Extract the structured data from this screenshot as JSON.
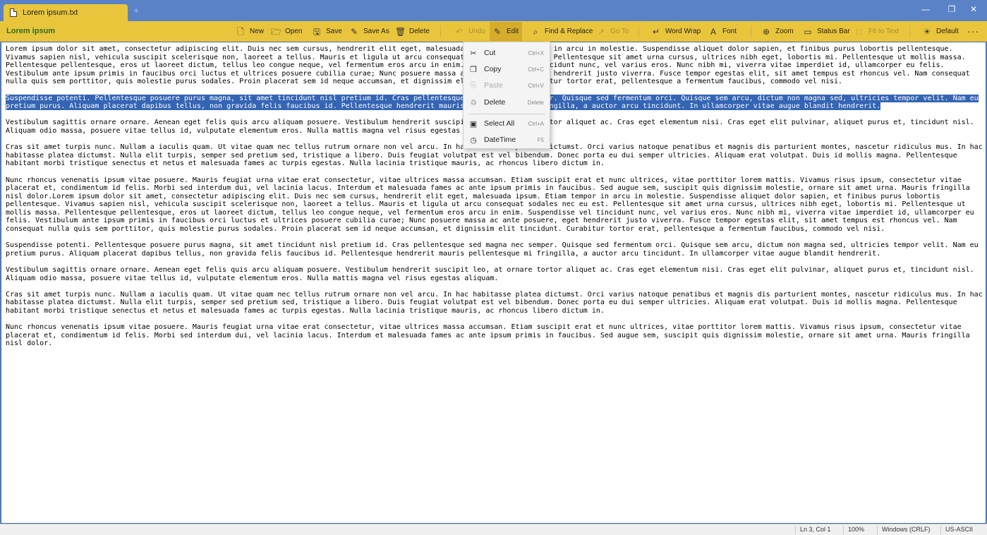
{
  "window": {
    "tab_label": "Lorem ipsum.txt",
    "new_tab_glyph": "+",
    "min_glyph": "—",
    "max_glyph": "❐",
    "close_glyph": "✕"
  },
  "toolbar": {
    "doc_title": "Lorem ipsum",
    "buttons": {
      "new": "New",
      "open": "Open",
      "save": "Save",
      "save_as": "Save As",
      "delete": "Delete",
      "undo": "Undo",
      "edit": "Edit",
      "find_replace": "Find & Replace",
      "go_to": "Go To",
      "word_wrap": "Word Wrap",
      "font": "Font",
      "zoom": "Zoom",
      "status_bar": "Status Bar",
      "fit_to_text": "Fit to Text",
      "default": "Default"
    },
    "more": "···"
  },
  "editor": {
    "paragraphs": [
      "Lorem ipsum dolor sit amet, consectetur adipiscing elit. Duis nec sem cursus, hendrerit elit eget, malesuada ipsum. Etiam tempor in arcu in molestie. Suspendisse aliquet dolor sapien, et finibus purus lobortis pellentesque. Vivamus sapien nisl, vehicula suscipit scelerisque non, laoreet a tellus. Mauris et ligula ut arcu consequat sodales nec eu est. Pellentesque sit amet urna cursus, ultrices nibh eget, lobortis mi. Pellentesque ut mollis massa. Pellentesque pellentesque, eros ut laoreet dictum, tellus leo congue neque, vel fermentum eros arcu in enim. Suspendisse vel tincidunt nunc, vel varius eros. Nunc nibh mi, viverra vitae imperdiet id, ullamcorper eu felis. Vestibulum ante ipsum primis in faucibus orci luctus et ultrices posuere cubilia curae; Nunc posuere massa ac ante posuere, eget hendrerit justo viverra. Fusce tempor egestas elit, sit amet tempus est rhoncus vel. Nam consequat nulla quis sem porttitor, quis molestie purus sodales. Proin placerat sem id neque accumsan, et dignissim elit tincidunt. Curabitur tortor erat, pellentesque a fermentum faucibus, commodo vel nisi.",
      "Suspendisse potenti. Pellentesque posuere purus magna, sit amet tincidunt nisl pretium id. Cras pellentesque sed magna nec semper. Quisque sed fermentum orci. Quisque sem arcu, dictum non magna sed, ultricies tempor velit. Nam eu pretium purus. Aliquam placerat dapibus tellus, non gravida felis faucibus id. Pellentesque hendrerit mauris pellentesque mi fringilla, a auctor arcu tincidunt. In ullamcorper vitae augue blandit hendrerit.",
      "Vestibulum sagittis ornare ornare. Aenean eget felis quis arcu aliquam posuere. Vestibulum hendrerit suscipit leo, at ornare tortor aliquet ac. Cras eget elementum nisi. Cras eget elit pulvinar, aliquet purus et, tincidunt nisl. Aliquam odio massa, posuere vitae tellus id, vulputate elementum eros. Nulla mattis magna vel risus egestas aliquam.",
      "Cras sit amet turpis nunc. Nullam a iaculis quam. Ut vitae quam nec tellus rutrum ornare non vel arcu. In hac habitasse platea dictumst. Orci varius natoque penatibus et magnis dis parturient montes, nascetur ridiculus mus. In hac habitasse platea dictumst. Nulla elit turpis, semper sed pretium sed, tristique a libero. Duis feugiat volutpat est vel bibendum. Donec porta eu dui semper ultricies. Aliquam erat volutpat. Duis id mollis magna. Pellentesque habitant morbi tristique senectus et netus et malesuada fames ac turpis egestas. Nulla lacinia tristique mauris, ac rhoncus libero dictum in.",
      "Nunc rhoncus venenatis ipsum vitae posuere. Mauris feugiat urna vitae erat consectetur, vitae ultrices massa accumsan. Etiam suscipit erat et nunc ultrices, vitae porttitor lorem mattis. Vivamus risus ipsum, consectetur vitae placerat et, condimentum id felis. Morbi sed interdum dui, vel lacinia lacus. Interdum et malesuada fames ac ante ipsum primis in faucibus. Sed augue sem, suscipit quis dignissim molestie, ornare sit amet urna. Mauris fringilla nisl dolor.Lorem ipsum dolor sit amet, consectetur adipiscing elit. Duis nec sem cursus, hendrerit elit eget, malesuada ipsum. Etiam tempor in arcu in molestie. Suspendisse aliquet dolor sapien, et finibus purus lobortis pellentesque. Vivamus sapien nisl, vehicula suscipit scelerisque non, laoreet a tellus. Mauris et ligula ut arcu consequat sodales nec eu est. Pellentesque sit amet urna cursus, ultrices nibh eget, lobortis mi. Pellentesque ut mollis massa. Pellentesque pellentesque, eros ut laoreet dictum, tellus leo congue neque, vel fermentum eros arcu in enim. Suspendisse vel tincidunt nunc, vel varius eros. Nunc nibh mi, viverra vitae imperdiet id, ullamcorper eu felis. Vestibulum ante ipsum primis in faucibus orci luctus et ultrices posuere cubilia curae; Nunc posuere massa ac ante posuere, eget hendrerit justo viverra. Fusce tempor egestas elit, sit amet tempus est rhoncus vel. Nam consequat nulla quis sem porttitor, quis molestie purus sodales. Proin placerat sem id neque accumsan, et dignissim elit tincidunt. Curabitur tortor erat, pellentesque a fermentum faucibus, commodo vel nisi.",
      "Suspendisse potenti. Pellentesque posuere purus magna, sit amet tincidunt nisl pretium id. Cras pellentesque sed magna nec semper. Quisque sed fermentum orci. Quisque sem arcu, dictum non magna sed, ultricies tempor velit. Nam eu pretium purus. Aliquam placerat dapibus tellus, non gravida felis faucibus id. Pellentesque hendrerit mauris pellentesque mi fringilla, a auctor arcu tincidunt. In ullamcorper vitae augue blandit hendrerit.",
      "Vestibulum sagittis ornare ornare. Aenean eget felis quis arcu aliquam posuere. Vestibulum hendrerit suscipit leo, at ornare tortor aliquet ac. Cras eget elementum nisi. Cras eget elit pulvinar, aliquet purus et, tincidunt nisl. Aliquam odio massa, posuere vitae tellus id, vulputate elementum eros. Nulla mattis magna vel risus egestas aliquam.",
      "Cras sit amet turpis nunc. Nullam a iaculis quam. Ut vitae quam nec tellus rutrum ornare non vel arcu. In hac habitasse platea dictumst. Orci varius natoque penatibus et magnis dis parturient montes, nascetur ridiculus mus. In hac habitasse platea dictumst. Nulla elit turpis, semper sed pretium sed, tristique a libero. Duis feugiat volutpat est vel bibendum. Donec porta eu dui semper ultricies. Aliquam erat volutpat. Duis id mollis magna. Pellentesque habitant morbi tristique senectus et netus et malesuada fames ac turpis egestas. Nulla lacinia tristique mauris, ac rhoncus libero dictum in.",
      "Nunc rhoncus venenatis ipsum vitae posuere. Mauris feugiat urna vitae erat consectetur, vitae ultrices massa accumsan. Etiam suscipit erat et nunc ultrices, vitae porttitor lorem mattis. Vivamus risus ipsum, consectetur vitae placerat et, condimentum id felis. Morbi sed interdum dui, vel lacinia lacus. Interdum et malesuada fames ac ante ipsum primis in faucibus. Sed augue sem, suscipit quis dignissim molestie, ornare sit amet urna. Mauris fringilla nisl dolor."
    ],
    "selected_paragraph_index": 1
  },
  "context_menu": {
    "items": [
      {
        "label": "Cut",
        "shortcut": "Ctrl+X",
        "icon": "scissors-icon",
        "enabled": true
      },
      {
        "label": "Copy",
        "shortcut": "Ctrl+C",
        "icon": "copy-icon",
        "enabled": true
      },
      {
        "label": "Paste",
        "shortcut": "Ctrl+V",
        "icon": "paste-icon",
        "enabled": false
      },
      {
        "label": "Delete",
        "shortcut": "Delete",
        "icon": "trash-icon",
        "enabled": true
      },
      {
        "label": "Select All",
        "shortcut": "Ctrl+A",
        "icon": "select-all-icon",
        "enabled": true
      },
      {
        "label": "DateTime",
        "shortcut": "F5",
        "icon": "clock-icon",
        "enabled": true
      }
    ]
  },
  "statusbar": {
    "position": "Ln 3, Col 1",
    "zoom": "100%",
    "line_ending": "Windows (CRLF)",
    "encoding": "US-ASCII"
  },
  "colors": {
    "titlebar": "#5a82c6",
    "accent": "#e9c53c",
    "selection": "#3464b4",
    "doc_title": "#2f6b1f"
  }
}
